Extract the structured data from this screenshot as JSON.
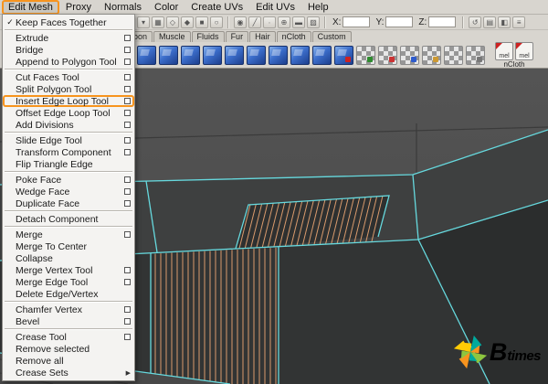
{
  "colors": {
    "accent_orange": "#F7941E",
    "edge_cyan": "#66D9DE",
    "loop_orange": "#D99A6C",
    "watermark_teal": "#00A99D",
    "watermark_green": "#8DC63F"
  },
  "menubar": {
    "items": [
      {
        "label": "Edit Mesh",
        "active": true
      },
      {
        "label": "Proxy"
      },
      {
        "label": "Normals"
      },
      {
        "label": "Color"
      },
      {
        "label": "Create UVs"
      },
      {
        "label": "Edit UVs"
      },
      {
        "label": "Help"
      }
    ]
  },
  "status_line": {
    "icon_groups_left": [
      [
        {
          "name": "select-hierarchy-icon",
          "glyph": "▾"
        },
        {
          "name": "select-object-icon",
          "glyph": "▦"
        },
        {
          "name": "select-component-icon",
          "glyph": "◇"
        },
        {
          "name": "select-mask-icon",
          "glyph": "◆"
        },
        {
          "name": "lock-selection-icon",
          "glyph": "■"
        },
        {
          "name": "highlight-selection-icon",
          "glyph": "○"
        }
      ],
      [
        {
          "name": "snap-grid-icon",
          "glyph": "◉"
        },
        {
          "name": "snap-curve-icon",
          "glyph": "╱"
        },
        {
          "name": "snap-point-icon",
          "glyph": "∙"
        },
        {
          "name": "snap-projected-center-icon",
          "glyph": "⊕"
        },
        {
          "name": "snap-view-plane-icon",
          "glyph": "▬"
        },
        {
          "name": "make-live-icon",
          "glyph": "▨"
        }
      ]
    ],
    "fields": [
      {
        "label": "X:",
        "value": ""
      },
      {
        "label": "Y:",
        "value": ""
      },
      {
        "label": "Z:",
        "value": ""
      }
    ],
    "icon_group_right": [
      {
        "name": "construction-history-icon",
        "glyph": "↺"
      },
      {
        "name": "render-view-icon",
        "glyph": "▤"
      },
      {
        "name": "ipr-render-icon",
        "glyph": "◧"
      },
      {
        "name": "render-settings-icon",
        "glyph": "≡"
      }
    ]
  },
  "shelf": {
    "tabs": [
      "oon",
      "Muscle",
      "Fluids",
      "Fur",
      "Hair",
      "nCloth",
      "Custom"
    ],
    "icons": [
      {
        "name": "ncloth-shelf-icon-1",
        "type": "blue"
      },
      {
        "name": "ncloth-shelf-icon-2",
        "type": "blue"
      },
      {
        "name": "ncloth-shelf-icon-3",
        "type": "blue"
      },
      {
        "name": "ncloth-shelf-icon-4",
        "type": "blue"
      },
      {
        "name": "ncloth-shelf-icon-5",
        "type": "blue"
      },
      {
        "name": "ncloth-shelf-icon-6",
        "type": "blue"
      },
      {
        "name": "ncloth-shelf-icon-7",
        "type": "blue"
      },
      {
        "name": "ncloth-shelf-icon-8",
        "type": "blue"
      },
      {
        "name": "ncloth-shelf-icon-9",
        "type": "blue"
      },
      {
        "name": "ncloth-shelf-icon-10",
        "type": "blue",
        "mark": "#cc2222"
      },
      {
        "name": "texture-checker-icon-1",
        "type": "checker",
        "mark": "#2e8b2e"
      },
      {
        "name": "texture-checker-icon-2",
        "type": "checker",
        "mark": "#cc3333"
      },
      {
        "name": "texture-checker-icon-3",
        "type": "checker",
        "mark": "#2e5bcc"
      },
      {
        "name": "texture-checker-icon-4",
        "type": "checker",
        "mark": "#cc9933"
      },
      {
        "name": "texture-checker-icon-5",
        "type": "checker"
      },
      {
        "name": "texture-checker-icon-6",
        "type": "checker",
        "mark": "#777777"
      }
    ],
    "mel_label": "mel",
    "ncloth_label": "nCloth"
  },
  "edit_mesh_menu": {
    "items": [
      {
        "label": "Keep Faces Together",
        "checked": true
      },
      {
        "separator": true
      },
      {
        "label": "Extrude",
        "option_box": true
      },
      {
        "label": "Bridge",
        "option_box": true
      },
      {
        "label": "Append to Polygon Tool",
        "option_box": true
      },
      {
        "separator": true
      },
      {
        "label": "Cut Faces Tool",
        "option_box": true
      },
      {
        "label": "Split Polygon Tool",
        "option_box": true
      },
      {
        "label": "Insert Edge Loop Tool",
        "option_box": true,
        "highlighted": true
      },
      {
        "label": "Offset Edge Loop Tool",
        "option_box": true
      },
      {
        "label": "Add Divisions",
        "option_box": true
      },
      {
        "separator": true
      },
      {
        "label": "Slide Edge Tool",
        "option_box": true
      },
      {
        "label": "Transform Component",
        "option_box": true
      },
      {
        "label": "Flip Triangle Edge"
      },
      {
        "separator": true
      },
      {
        "label": "Poke Face",
        "option_box": true
      },
      {
        "label": "Wedge Face",
        "option_box": true
      },
      {
        "label": "Duplicate Face",
        "option_box": true
      },
      {
        "separator": true
      },
      {
        "label": "Detach Component"
      },
      {
        "separator": true
      },
      {
        "label": "Merge",
        "option_box": true
      },
      {
        "label": "Merge To Center"
      },
      {
        "label": "Collapse"
      },
      {
        "label": "Merge Vertex Tool",
        "option_box": true
      },
      {
        "label": "Merge Edge Tool",
        "option_box": true
      },
      {
        "label": "Delete Edge/Vertex"
      },
      {
        "separator": true
      },
      {
        "label": "Chamfer Vertex",
        "option_box": true
      },
      {
        "label": "Bevel",
        "option_box": true
      },
      {
        "separator": true
      },
      {
        "label": "Crease Tool",
        "option_box": true
      },
      {
        "label": "Remove selected"
      },
      {
        "label": "Remove all"
      },
      {
        "label": "Crease Sets",
        "submenu": true
      }
    ]
  },
  "watermark": {
    "b": "B",
    "times": "times"
  }
}
